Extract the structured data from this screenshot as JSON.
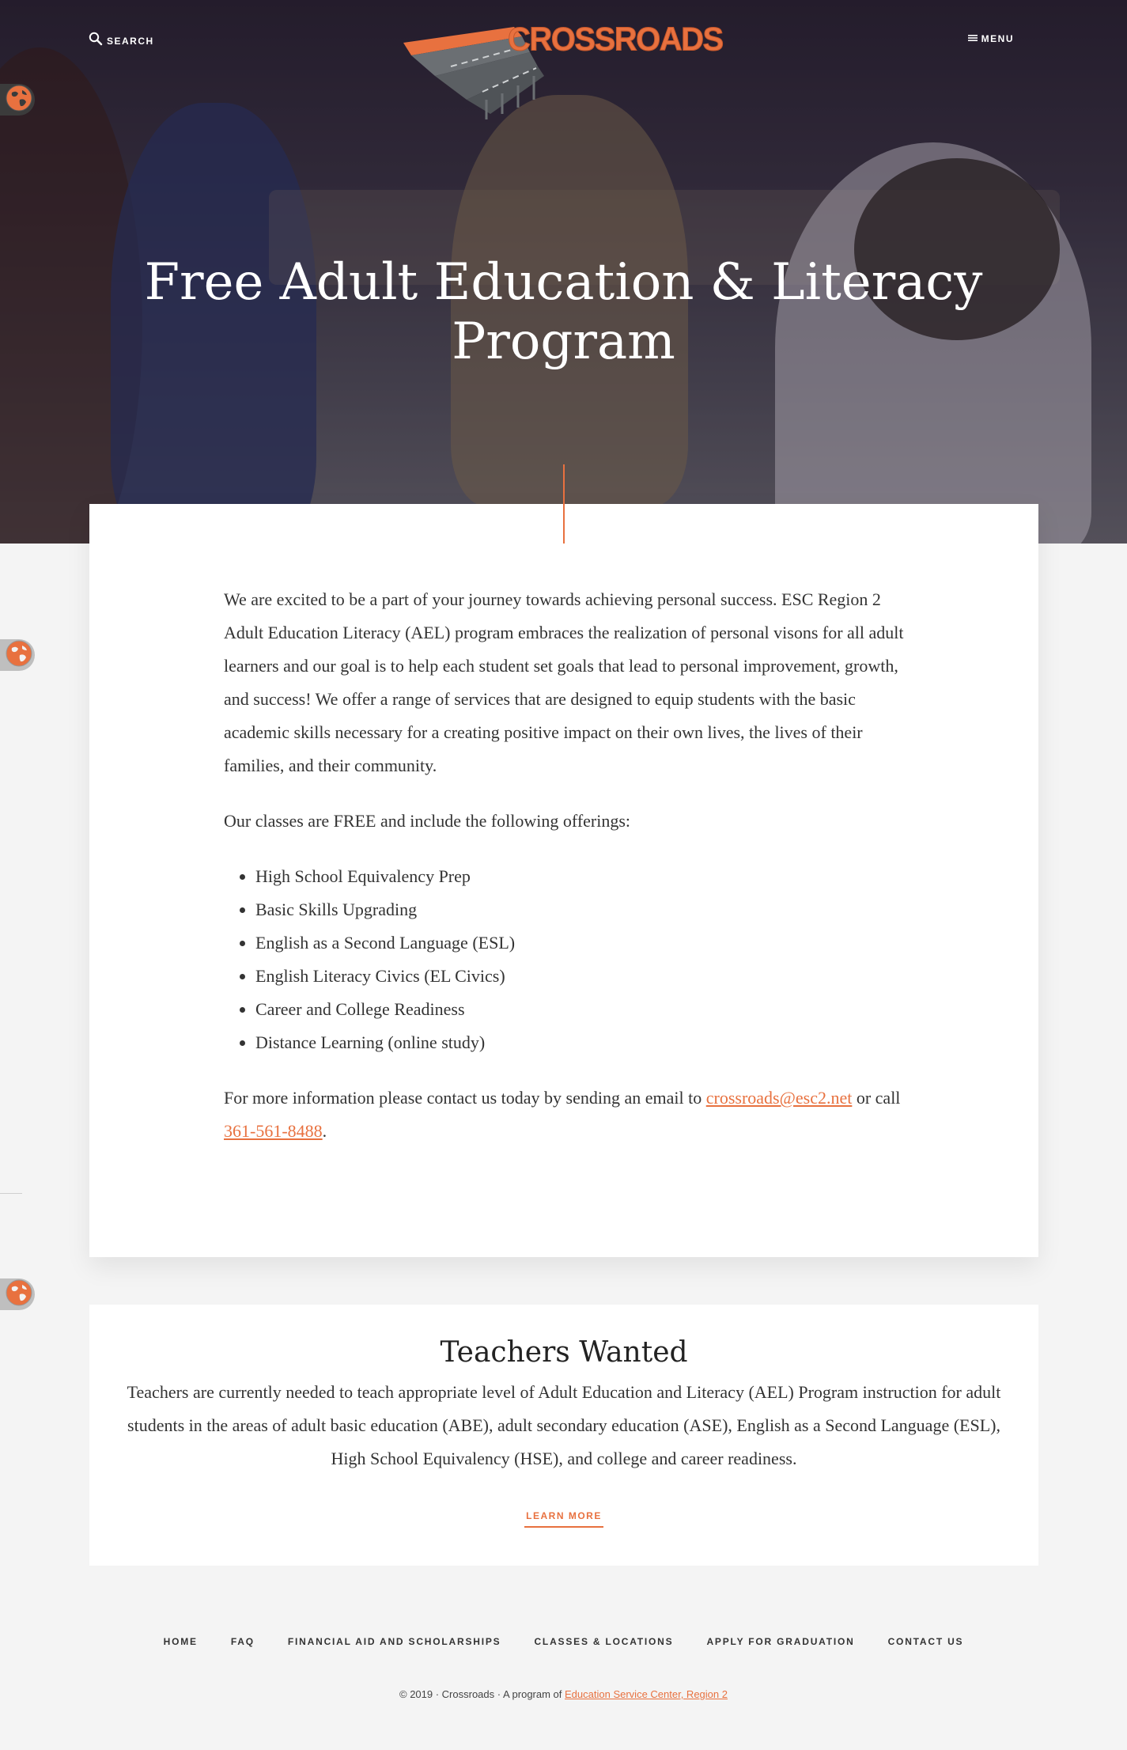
{
  "header": {
    "search_label": "SEARCH",
    "menu_label": "MENU",
    "logo_text": "CROSSROADS"
  },
  "hero": {
    "title": "Free Adult Education & Literacy Program"
  },
  "intro": {
    "paragraph": "We are excited to be a part of your journey towards achieving personal success. ESC Region 2 Adult Education Literacy (AEL) program embraces the realization of personal visons for all adult learners and our goal is to help each student set goals that lead to personal improvement, growth, and success! We offer a range of services that are designed to equip students with the basic academic skills necessary for a creating positive impact on their own lives, the lives of their families, and their community.",
    "offerings_intro": "Our classes are FREE and include the following offerings:",
    "offerings": [
      "High School Equivalency Prep",
      "Basic Skills Upgrading",
      "English as a Second Language (ESL)",
      "English Literacy Civics (EL Civics)",
      "Career and College Readiness",
      "Distance Learning (online study)"
    ],
    "contact": {
      "prefix": "For more information please contact us today by sending an email to ",
      "email": "crossroads@esc2.net",
      "middle": " or call ",
      "phone": "361-561-8488",
      "suffix": "."
    }
  },
  "teachers": {
    "title": "Teachers Wanted",
    "text": "Teachers are currently needed to teach appropriate level of Adult Education and Literacy (AEL) Program instruction for adult students in the areas of adult basic education (ABE), adult secondary education (ASE), English as a Second Language (ESL), High School Equivalency (HSE), and college and career readiness.",
    "button_label": "LEARN MORE"
  },
  "footer": {
    "nav": [
      "HOME",
      "FAQ",
      "FINANCIAL AID AND SCHOLARSHIPS",
      "CLASSES & LOCATIONS",
      "APPLY FOR GRADUATION",
      "CONTACT US"
    ],
    "copyright_prefix": "© 2019 · Crossroads · A program of ",
    "copyright_link": "Education Service Center, Region 2"
  },
  "colors": {
    "accent": "#e8713f",
    "background": "#f4f4f4",
    "card": "#ffffff"
  },
  "icons": [
    "search-icon",
    "menu-icon",
    "globe-icon"
  ]
}
